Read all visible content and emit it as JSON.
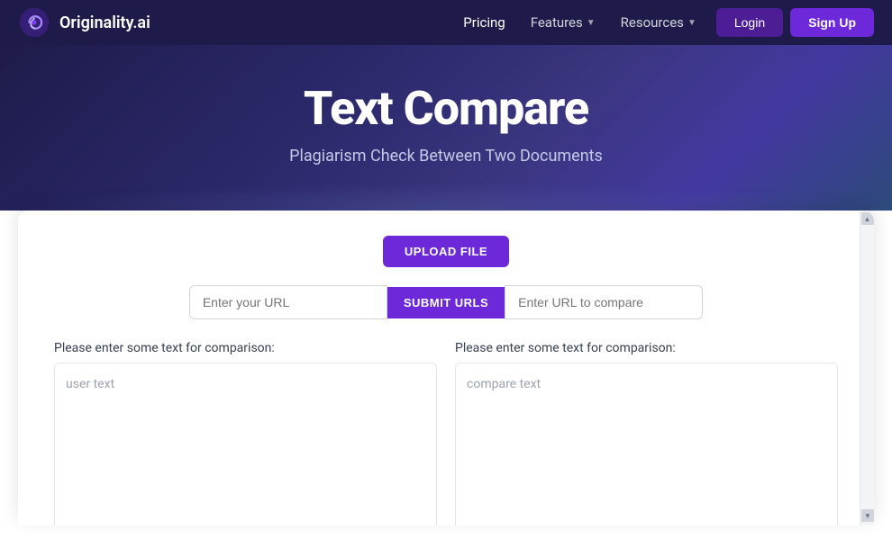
{
  "brand": {
    "name": "Originality.ai"
  },
  "nav": {
    "pricing_label": "Pricing",
    "features_label": "Features",
    "resources_label": "Resources",
    "login_label": "Login",
    "signup_label": "Sign Up"
  },
  "hero": {
    "title": "Text Compare",
    "subtitle": "Plagiarism Check Between Two Documents"
  },
  "toolbar": {
    "upload_label": "UPLOAD FILE",
    "submit_urls_label": "SUBMIT URLS"
  },
  "url_inputs": {
    "left_placeholder": "Enter your URL",
    "right_placeholder": "Enter URL to compare"
  },
  "text_panels": {
    "left_label": "Please enter some text for comparison:",
    "left_placeholder": "user text",
    "right_label": "Please enter some text for comparison:",
    "right_placeholder": "compare text"
  },
  "colors": {
    "purple_dark": "#1e1b4b",
    "purple_mid": "#6d28d9",
    "purple_btn": "#4c1d95"
  }
}
